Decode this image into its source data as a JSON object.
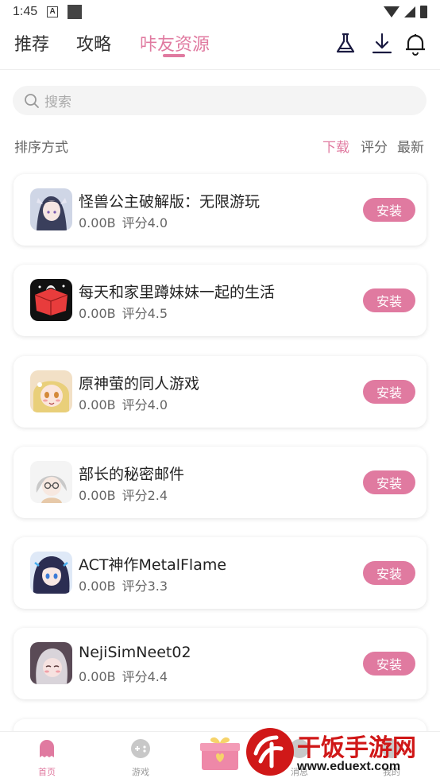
{
  "status_bar": {
    "time": "1:45"
  },
  "top_nav": {
    "tabs": [
      "推荐",
      "攻略",
      "咔友资源"
    ],
    "active_tab": 2,
    "icons": [
      "flask-icon",
      "download-icon",
      "bell-icon"
    ]
  },
  "search": {
    "placeholder": "搜索"
  },
  "sort": {
    "label": "排序方式",
    "options": [
      "下载",
      "评分",
      "最新"
    ],
    "active": 0
  },
  "games": [
    {
      "title": "怪兽公主破解版：无限游玩",
      "size": "0.00B",
      "rating": "评分4.0",
      "action": "安装"
    },
    {
      "title": "每天和家里蹲妹妹一起的生活",
      "size": "0.00B",
      "rating": "评分4.5",
      "action": "安装"
    },
    {
      "title": "原神萤的同人游戏",
      "size": "0.00B",
      "rating": "评分4.0",
      "action": "安装"
    },
    {
      "title": "部长的秘密邮件",
      "size": "0.00B",
      "rating": "评分2.4",
      "action": "安装"
    },
    {
      "title": "ACT神作MetalFlame",
      "size": "0.00B",
      "rating": "评分3.3",
      "action": "安装"
    },
    {
      "title": "NejiSimNeet02",
      "size": "0.00B",
      "rating": "评分4.4",
      "action": "安装"
    }
  ],
  "bottom_nav": {
    "items": [
      "首页",
      "游戏",
      "消息",
      "我的"
    ],
    "active": 0
  },
  "watermark": {
    "brand": "干饭手游网",
    "url": "www.eduext.com"
  },
  "colors": {
    "accent": "#e07aa0",
    "watermark_red": "#d01818"
  }
}
